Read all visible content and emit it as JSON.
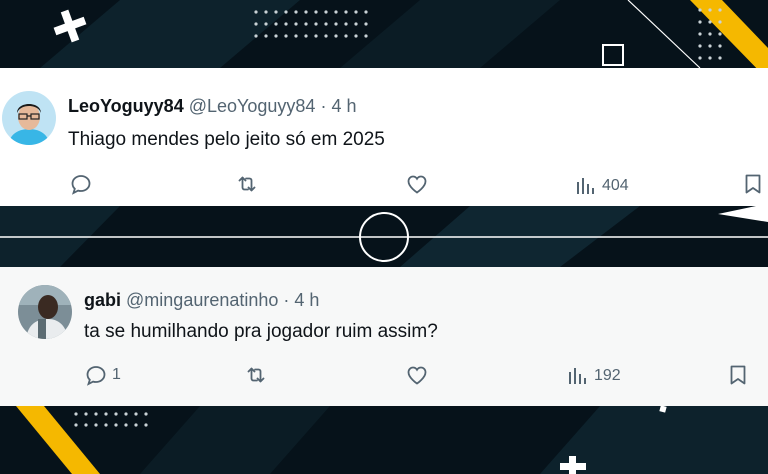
{
  "tweets": [
    {
      "name": "LeoYoguyy84",
      "handle": "@LeoYoguyy84",
      "time": "· 4 h",
      "text": "Thiago mendes pelo jeito só em 2025",
      "replies": "",
      "views": "404"
    },
    {
      "name": "gabi",
      "handle": "@mingaurenatinho",
      "time": "· 4 h",
      "text": "ta se humilhando pra jogador ruim assim?",
      "replies": "1",
      "views": "192"
    }
  ],
  "icons": [
    "reply-icon",
    "retweet-icon",
    "like-icon",
    "views-icon",
    "bookmark-icon"
  ],
  "colors": {
    "accent_yellow": "#f5b800",
    "background": "#06121a",
    "icon_gray": "#536471"
  }
}
